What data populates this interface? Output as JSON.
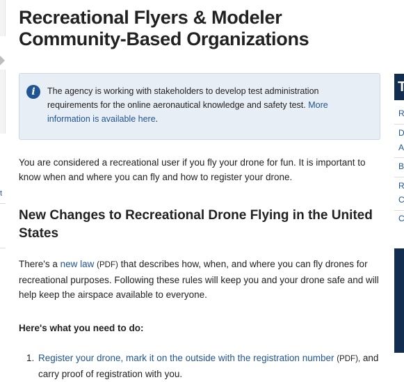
{
  "page": {
    "title": "Recreational Flyers & Modeler Community-Based Organizations"
  },
  "alert": {
    "icon": "info-icon",
    "text_before": "The agency is working with stakeholders to develop test administration requirements for the online aeronautical knowledge and safety test.",
    "link_text": "More information is available here",
    "text_after": "."
  },
  "intro": {
    "text": "You are considered a recreational user if you fly your drone for fun. It is important to know when and where you can fly and how to register your drone."
  },
  "section": {
    "heading": "New Changes to Recreational Drone Flying in the United States",
    "para_before": "There's a",
    "law_link": "new law",
    "pdf_tag": "(PDF)",
    "para_after": "that describes how, when, and where you can fly drones for recreational purposes. Following these rules will keep you and your drone safe and will help keep the airspace available to everyone.",
    "todo_heading": "Here's what you need to do:",
    "steps": [
      {
        "num": "1.",
        "link_text": "Register your drone, mark it on the outside with the registration number",
        "pdf_tag": "(PDF),",
        "text_after": "and carry proof of registration with you."
      }
    ]
  },
  "right_sidebar": {
    "head_letter": "T",
    "items": [
      "R",
      "D",
      "A",
      "B",
      "R",
      "C",
      "C"
    ]
  },
  "left_sidebar": {
    "fragment": "t"
  }
}
